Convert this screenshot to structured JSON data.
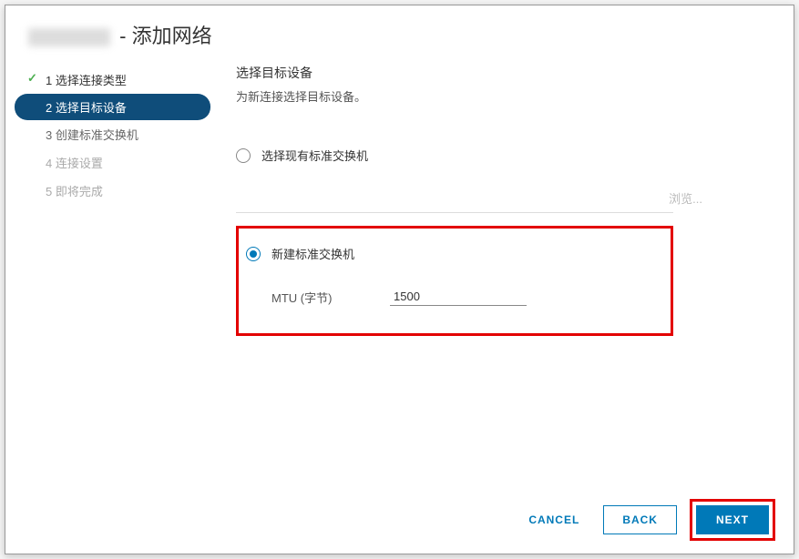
{
  "title_suffix": "- 添加网络",
  "steps": [
    {
      "label": "1 选择连接类型",
      "state": "done"
    },
    {
      "label": "2 选择目标设备",
      "state": "active"
    },
    {
      "label": "3 创建标准交换机",
      "state": "normal"
    },
    {
      "label": "4 连接设置",
      "state": "disabled"
    },
    {
      "label": "5 即将完成",
      "state": "disabled"
    }
  ],
  "content": {
    "section_title": "选择目标设备",
    "section_desc": "为新连接选择目标设备。",
    "radio_existing": "选择现有标准交换机",
    "browse": "浏览...",
    "radio_new": "新建标准交换机",
    "mtu_label": "MTU (字节)",
    "mtu_value": "1500",
    "radio_selected": "new"
  },
  "footer": {
    "cancel": "CANCEL",
    "back": "BACK",
    "next": "NEXT"
  }
}
